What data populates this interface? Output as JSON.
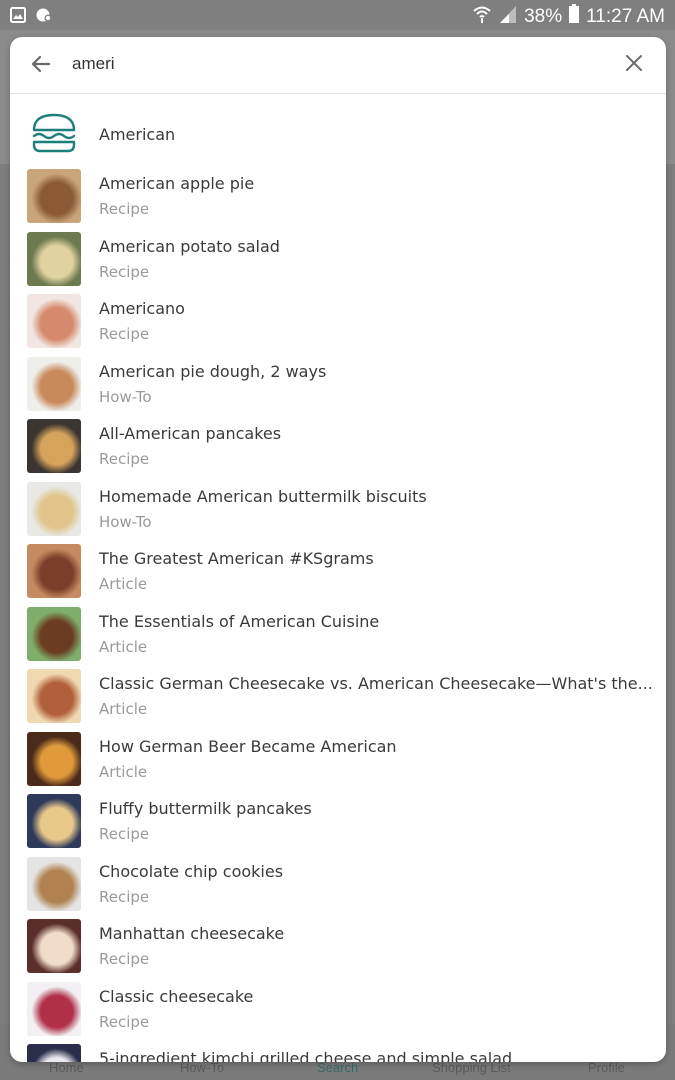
{
  "status_bar": {
    "battery": "38%",
    "time": "11:27 AM",
    "icons": [
      "image-icon",
      "notification-icon",
      "wifi-icon",
      "signal-icon",
      "battery-icon"
    ]
  },
  "search": {
    "query": "ameri",
    "back_icon": "arrow-left-icon",
    "clear_icon": "close-icon"
  },
  "category": {
    "label": "American",
    "icon": "burger-icon",
    "icon_color": "#1a8079"
  },
  "results": [
    {
      "title": "American apple pie",
      "type": "Recipe",
      "thumb": [
        "#c9a57a",
        "#8a5a34"
      ]
    },
    {
      "title": "American potato salad",
      "type": "Recipe",
      "thumb": [
        "#6d7a4f",
        "#e0d3a0"
      ]
    },
    {
      "title": "Americano",
      "type": "Recipe",
      "thumb": [
        "#f1e6e1",
        "#d58a6d"
      ]
    },
    {
      "title": "American pie dough, 2 ways",
      "type": "How-To",
      "thumb": [
        "#eeeeea",
        "#c98a5a"
      ]
    },
    {
      "title": "All-American pancakes",
      "type": "Recipe",
      "thumb": [
        "#3a3530",
        "#d6a35b"
      ]
    },
    {
      "title": "Homemade American buttermilk biscuits",
      "type": "How-To",
      "thumb": [
        "#e8e8e4",
        "#e0c48a"
      ]
    },
    {
      "title": "The Greatest American #KSgrams",
      "type": "Article",
      "thumb": [
        "#c58a5f",
        "#7a3e2a"
      ]
    },
    {
      "title": "The Essentials of American Cuisine",
      "type": "Article",
      "thumb": [
        "#7fae6a",
        "#6b3b22"
      ]
    },
    {
      "title": "Classic German Cheesecake vs. American Cheesecake—What's the...",
      "type": "Article",
      "thumb": [
        "#f0d8b0",
        "#b0603a"
      ]
    },
    {
      "title": "How German Beer Became American",
      "type": "Article",
      "thumb": [
        "#4a2a1a",
        "#e09a3a"
      ]
    },
    {
      "title": "Fluffy buttermilk pancakes",
      "type": "Recipe",
      "thumb": [
        "#2f3a5a",
        "#e8c98a"
      ]
    },
    {
      "title": "Chocolate chip cookies",
      "type": "Recipe",
      "thumb": [
        "#e4e4e4",
        "#b0824f"
      ]
    },
    {
      "title": "Manhattan cheesecake",
      "type": "Recipe",
      "thumb": [
        "#5a2e2a",
        "#f0dcc8"
      ]
    },
    {
      "title": "Classic cheesecake",
      "type": "Recipe",
      "thumb": [
        "#f2f0f2",
        "#b0304a"
      ]
    },
    {
      "title": "5-ingredient kimchi grilled cheese and simple salad",
      "type": "",
      "thumb": [
        "#2a2e4a",
        "#ece8f0"
      ]
    }
  ],
  "bottom_nav": [
    "Home",
    "How-To",
    "Search",
    "Shopping List",
    "Profile"
  ]
}
